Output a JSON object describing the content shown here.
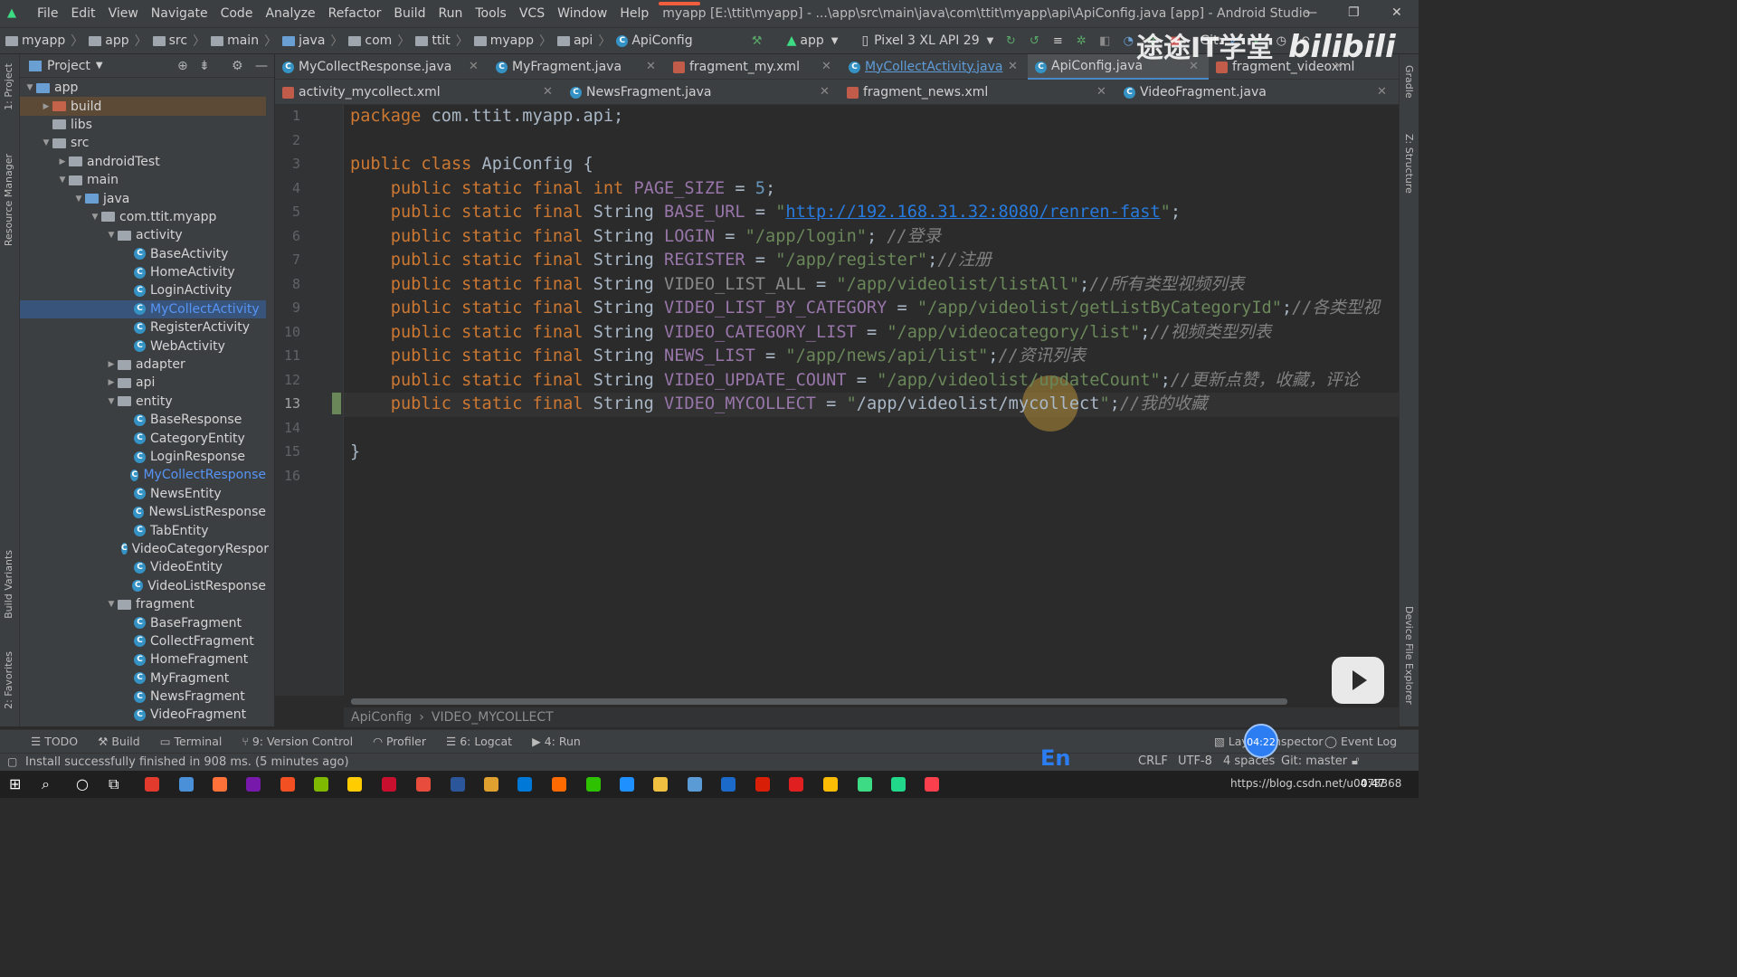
{
  "menubar": {
    "items": [
      "File",
      "Edit",
      "View",
      "Navigate",
      "Code",
      "Analyze",
      "Refactor",
      "Build",
      "Run",
      "Tools",
      "VCS",
      "Window",
      "Help"
    ],
    "title": "myapp [E:\\ttit\\myapp] - ...\\app\\src\\main\\java\\com\\ttit\\myapp\\api\\ApiConfig.java [app] - Android Studio",
    "minimize": "—",
    "restore": "❐",
    "close": "✕"
  },
  "navbar": {
    "crumbs": [
      "myapp",
      "app",
      "src",
      "main",
      "java",
      "com",
      "ttit",
      "myapp",
      "api",
      "ApiConfig"
    ],
    "run_config": "app",
    "device": "Pixel 3 XL API 29",
    "git_label": "Git:"
  },
  "overlay": {
    "watermark": "途途IT学堂",
    "logo": "bilibili",
    "timer": "04:22"
  },
  "left_strip": {
    "project": "1: Project",
    "resource_manager": "Resource Manager",
    "build_variants": "Build Variants",
    "favorites": "2: Favorites"
  },
  "right_strip": {
    "gradle": "Gradle",
    "structure": "Z: Structure",
    "device_file": "Device File Explorer"
  },
  "project_panel": {
    "title": "Project",
    "tree": [
      {
        "label": "app",
        "depth": 0,
        "arrow": "▼",
        "type": "module"
      },
      {
        "label": "build",
        "depth": 1,
        "arrow": "▶",
        "type": "folder-red",
        "highlight": "build"
      },
      {
        "label": "libs",
        "depth": 1,
        "arrow": "",
        "type": "folder"
      },
      {
        "label": "src",
        "depth": 1,
        "arrow": "▼",
        "type": "folder"
      },
      {
        "label": "androidTest",
        "depth": 2,
        "arrow": "▶",
        "type": "folder"
      },
      {
        "label": "main",
        "depth": 2,
        "arrow": "▼",
        "type": "folder"
      },
      {
        "label": "java",
        "depth": 3,
        "arrow": "▼",
        "type": "folder-blue"
      },
      {
        "label": "com.ttit.myapp",
        "depth": 4,
        "arrow": "▼",
        "type": "folder"
      },
      {
        "label": "activity",
        "depth": 5,
        "arrow": "▼",
        "type": "folder"
      },
      {
        "label": "BaseActivity",
        "depth": 6,
        "arrow": "",
        "type": "class"
      },
      {
        "label": "HomeActivity",
        "depth": 6,
        "arrow": "",
        "type": "class"
      },
      {
        "label": "LoginActivity",
        "depth": 6,
        "arrow": "",
        "type": "class"
      },
      {
        "label": "MyCollectActivity",
        "depth": 6,
        "arrow": "",
        "type": "class",
        "highlight": "selected"
      },
      {
        "label": "RegisterActivity",
        "depth": 6,
        "arrow": "",
        "type": "class"
      },
      {
        "label": "WebActivity",
        "depth": 6,
        "arrow": "",
        "type": "class"
      },
      {
        "label": "adapter",
        "depth": 5,
        "arrow": "▶",
        "type": "folder"
      },
      {
        "label": "api",
        "depth": 5,
        "arrow": "▶",
        "type": "folder"
      },
      {
        "label": "entity",
        "depth": 5,
        "arrow": "▼",
        "type": "folder"
      },
      {
        "label": "BaseResponse",
        "depth": 6,
        "arrow": "",
        "type": "class"
      },
      {
        "label": "CategoryEntity",
        "depth": 6,
        "arrow": "",
        "type": "class"
      },
      {
        "label": "LoginResponse",
        "depth": 6,
        "arrow": "",
        "type": "class"
      },
      {
        "label": "MyCollectResponse",
        "depth": 6,
        "arrow": "",
        "type": "class",
        "highlight": "blue"
      },
      {
        "label": "NewsEntity",
        "depth": 6,
        "arrow": "",
        "type": "class"
      },
      {
        "label": "NewsListResponse",
        "depth": 6,
        "arrow": "",
        "type": "class"
      },
      {
        "label": "TabEntity",
        "depth": 6,
        "arrow": "",
        "type": "class"
      },
      {
        "label": "VideoCategoryRespor",
        "depth": 6,
        "arrow": "",
        "type": "class"
      },
      {
        "label": "VideoEntity",
        "depth": 6,
        "arrow": "",
        "type": "class"
      },
      {
        "label": "VideoListResponse",
        "depth": 6,
        "arrow": "",
        "type": "class"
      },
      {
        "label": "fragment",
        "depth": 5,
        "arrow": "▼",
        "type": "folder"
      },
      {
        "label": "BaseFragment",
        "depth": 6,
        "arrow": "",
        "type": "class"
      },
      {
        "label": "CollectFragment",
        "depth": 6,
        "arrow": "",
        "type": "class"
      },
      {
        "label": "HomeFragment",
        "depth": 6,
        "arrow": "",
        "type": "class"
      },
      {
        "label": "MyFragment",
        "depth": 6,
        "arrow": "",
        "type": "class"
      },
      {
        "label": "NewsFragment",
        "depth": 6,
        "arrow": "",
        "type": "class"
      },
      {
        "label": "VideoFragment",
        "depth": 6,
        "arrow": "",
        "type": "class"
      }
    ]
  },
  "tabs_row1": [
    {
      "label": "MyCollectResponse.java",
      "kind": "java"
    },
    {
      "label": "MyFragment.java",
      "kind": "java"
    },
    {
      "label": "fragment_my.xml",
      "kind": "xml"
    },
    {
      "label": "MyCollectActivity.java",
      "kind": "java",
      "style": "underline"
    },
    {
      "label": "ApiConfig.java",
      "kind": "java",
      "active": true
    },
    {
      "label": "fragment_videoxml",
      "kind": "xml"
    }
  ],
  "tabs_row2": [
    {
      "label": "activity_mycollect.xml",
      "kind": "xml"
    },
    {
      "label": "NewsFragment.java",
      "kind": "java"
    },
    {
      "label": "fragment_news.xml",
      "kind": "xml"
    },
    {
      "label": "VideoFragment.java",
      "kind": "java"
    }
  ],
  "editor": {
    "current_line": 13,
    "line_numbers": [
      "1",
      "2",
      "3",
      "4",
      "5",
      "6",
      "7",
      "8",
      "9",
      "10",
      "11",
      "12",
      "13",
      "14",
      "15",
      "16"
    ],
    "lines": [
      [
        [
          "kw",
          "package"
        ],
        [
          "",
          "com.ttit.myapp.api;"
        ]
      ],
      [],
      [
        [
          "kw",
          "public class"
        ],
        [
          "",
          "ApiConfig {"
        ]
      ],
      [
        [
          "",
          "    "
        ],
        [
          "kw",
          "public static final int"
        ],
        [
          "",
          "  "
        ],
        [
          "fld",
          "PAGE_SIZE"
        ],
        [
          "",
          ""
        ],
        [
          "",
          ""
        ],
        [
          "",
          ""
        ],
        [
          "",
          ""
        ],
        [
          "",
          ""
        ],
        [
          "",
          ""
        ]
      ],
      [],
      [],
      [],
      [],
      [],
      [],
      [],
      [],
      [],
      [],
      [
        [
          "",
          "}"
        ]
      ],
      []
    ],
    "code": [
      {
        "segments": [
          [
            "kw",
            "package "
          ],
          [
            "",
            "com.ttit.myapp.api;"
          ]
        ]
      },
      {
        "segments": []
      },
      {
        "segments": [
          [
            "kw",
            "public class "
          ],
          [
            "",
            "ApiConfig {"
          ]
        ]
      },
      {
        "segments": [
          [
            "",
            "    "
          ],
          [
            "kw",
            "public static final int "
          ],
          [
            "fld",
            "PAGE_SIZE"
          ],
          [
            "",
            " = "
          ],
          [
            "num",
            "5"
          ],
          [
            "",
            ";"
          ]
        ]
      },
      {
        "segments": [
          [
            "",
            "    "
          ],
          [
            "kw",
            "public static final "
          ],
          [
            "",
            "String "
          ],
          [
            "fld",
            "BASE_URL"
          ],
          [
            "",
            " = "
          ],
          [
            "str",
            "\""
          ],
          [
            "link",
            "http://192.168.31.32:8080/renren-fast"
          ],
          [
            "str",
            "\""
          ],
          [
            "",
            ";"
          ]
        ]
      },
      {
        "segments": [
          [
            "",
            "    "
          ],
          [
            "kw",
            "public static final "
          ],
          [
            "",
            "String "
          ],
          [
            "fld",
            "LOGIN"
          ],
          [
            "",
            " = "
          ],
          [
            "str",
            "\"/app/login\""
          ],
          [
            "",
            "; "
          ],
          [
            "cmt",
            "//登录"
          ]
        ]
      },
      {
        "segments": [
          [
            "",
            "    "
          ],
          [
            "kw",
            "public static final "
          ],
          [
            "",
            "String "
          ],
          [
            "fld",
            "REGISTER"
          ],
          [
            "",
            " = "
          ],
          [
            "str",
            "\"/app/register\""
          ],
          [
            "",
            ";"
          ],
          [
            "cmt",
            "//注册"
          ]
        ]
      },
      {
        "segments": [
          [
            "",
            "    "
          ],
          [
            "kw",
            "public static final "
          ],
          [
            "",
            "String "
          ],
          [
            "gray",
            "VIDEO_LIST_ALL"
          ],
          [
            "",
            " = "
          ],
          [
            "str",
            "\"/app/videolist/listAll\""
          ],
          [
            "",
            ";"
          ],
          [
            "cmt",
            "//所有类型视频列表"
          ]
        ]
      },
      {
        "segments": [
          [
            "",
            "    "
          ],
          [
            "kw",
            "public static final "
          ],
          [
            "",
            "String "
          ],
          [
            "fld",
            "VIDEO_LIST_BY_CATEGORY"
          ],
          [
            "",
            " = "
          ],
          [
            "str",
            "\"/app/videolist/getListByCategoryId\""
          ],
          [
            "",
            ";"
          ],
          [
            "cmt",
            "//各类型视"
          ]
        ]
      },
      {
        "segments": [
          [
            "",
            "    "
          ],
          [
            "kw",
            "public static final "
          ],
          [
            "",
            "String "
          ],
          [
            "fld",
            "VIDEO_CATEGORY_LIST"
          ],
          [
            "",
            " = "
          ],
          [
            "str",
            "\"/app/videocategory/list\""
          ],
          [
            "",
            ";"
          ],
          [
            "cmt",
            "//视频类型列表"
          ]
        ]
      },
      {
        "segments": [
          [
            "",
            "    "
          ],
          [
            "kw",
            "public static final "
          ],
          [
            "",
            "String "
          ],
          [
            "fld",
            "NEWS_LIST"
          ],
          [
            "",
            " = "
          ],
          [
            "str",
            "\"/app/news/api/list\""
          ],
          [
            "",
            ";"
          ],
          [
            "cmt",
            "//资讯列表"
          ]
        ]
      },
      {
        "segments": [
          [
            "",
            "    "
          ],
          [
            "kw",
            "public static final "
          ],
          [
            "",
            "String "
          ],
          [
            "fld",
            "VIDEO_UPDATE_COUNT"
          ],
          [
            "",
            " = "
          ],
          [
            "str",
            "\"/app/videolist/updateCount\""
          ],
          [
            "",
            ";"
          ],
          [
            "cmt",
            "//更新点赞，收藏，评论"
          ]
        ]
      },
      {
        "segments": [
          [
            "",
            "    "
          ],
          [
            "kw",
            "public static final "
          ],
          [
            "",
            "String "
          ],
          [
            "fld",
            "VIDEO_MYCOLLECT"
          ],
          [
            "",
            " = "
          ],
          [
            "str",
            "\""
          ],
          [
            "",
            "/app/videolist/mycollect"
          ],
          [
            "str",
            "\""
          ],
          [
            "",
            ";"
          ],
          [
            "cmt",
            "//我的收藏"
          ]
        ]
      },
      {
        "segments": []
      },
      {
        "segments": [
          [
            "",
            "}"
          ]
        ]
      },
      {
        "segments": []
      }
    ],
    "breadcrumb": [
      "ApiConfig",
      "VIDEO_MYCOLLECT"
    ]
  },
  "bottom_tools": [
    "TODO",
    "Build",
    "Terminal",
    "9: Version Control",
    "Profiler",
    "6: Logcat",
    "4: Run"
  ],
  "bottom_right_tools": [
    "Layout Inspector",
    "Event Log"
  ],
  "status": {
    "message": "Install successfully finished in 908 ms. (5 minutes ago)",
    "ime": "En",
    "line_sep": "CRLF",
    "encoding": "UTF-8",
    "indent": "4 spaces",
    "git": "Git: master"
  },
  "taskbar": {
    "tray_text": "https://blog.csdn.net/u0473368",
    "clock": "0:47"
  },
  "colors": {
    "keyword": "#cc7832",
    "string": "#6a8759",
    "number": "#6897bb",
    "field": "#9876aa",
    "comment": "#808080",
    "accent": "#4a88c7"
  }
}
